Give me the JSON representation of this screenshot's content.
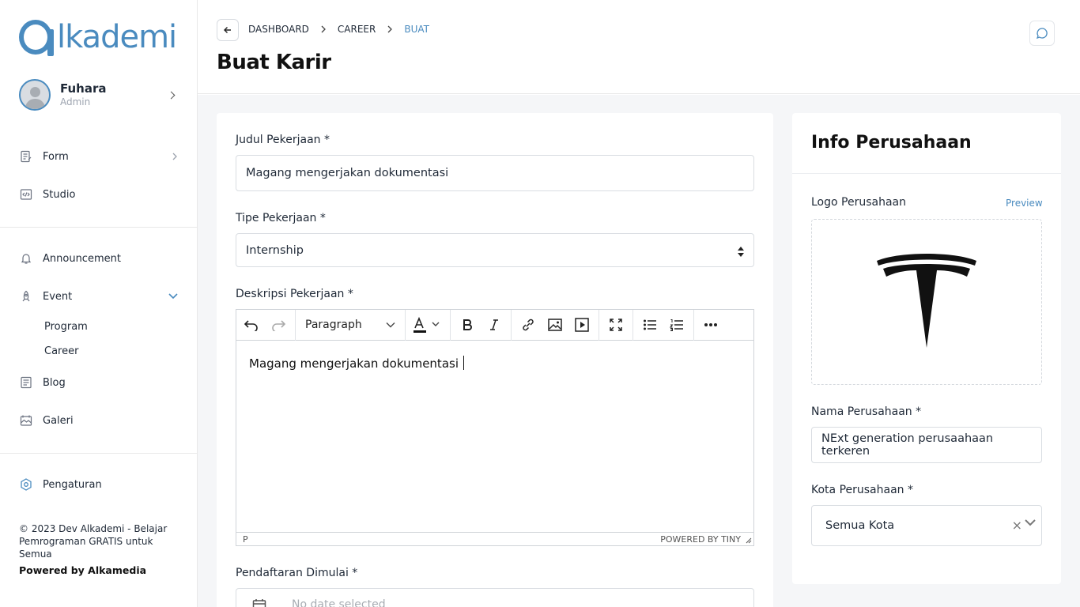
{
  "brand": {
    "logo_text": "lkademi",
    "color": "#4a8bbf"
  },
  "user": {
    "name": "Fuhara",
    "role": "Admin"
  },
  "sidebar": {
    "items": [
      {
        "label": "Form",
        "icon": "form-icon"
      },
      {
        "label": "Studio",
        "icon": "code-icon"
      },
      {
        "label": "Announcement",
        "icon": "bell-icon"
      },
      {
        "label": "Event",
        "icon": "rocket-icon"
      },
      {
        "label": "Blog",
        "icon": "blog-icon"
      },
      {
        "label": "Galeri",
        "icon": "gallery-icon"
      },
      {
        "label": "Pengaturan",
        "icon": "settings-icon"
      }
    ],
    "event_sub": [
      "Program",
      "Career"
    ],
    "footer_copy": "© 2023 Dev Alkademi - Belajar Pemrograman GRATIS untuk Semua",
    "footer_power": "Powered by Alkamedia"
  },
  "breadcrumb": [
    "DASHBOARD",
    "CAREER",
    "BUAT"
  ],
  "page_title": "Buat Karir",
  "form": {
    "job_title_label": "Judul Pekerjaan *",
    "job_title_value": "Magang mengerjakan dokumentasi",
    "job_type_label": "Tipe Pekerjaan *",
    "job_type_value": "Internship",
    "desc_label": "Deskripsi Pekerjaan *",
    "editor": {
      "block_format": "Paragraph",
      "content": "Magang mengerjakan dokumentasi",
      "status_path": "P",
      "powered": "POWERED BY TINY"
    },
    "reg_start_label": "Pendaftaran Dimulai *",
    "reg_start_placeholder": "No date selected"
  },
  "company": {
    "title": "Info Perusahaan",
    "logo_label": "Logo Perusahaan",
    "preview_label": "Preview",
    "name_label": "Nama Perusahaan *",
    "name_value": "NExt generation perusaahaan terkeren",
    "city_label": "Kota Perusahaan *",
    "city_value": "Semua Kota"
  }
}
